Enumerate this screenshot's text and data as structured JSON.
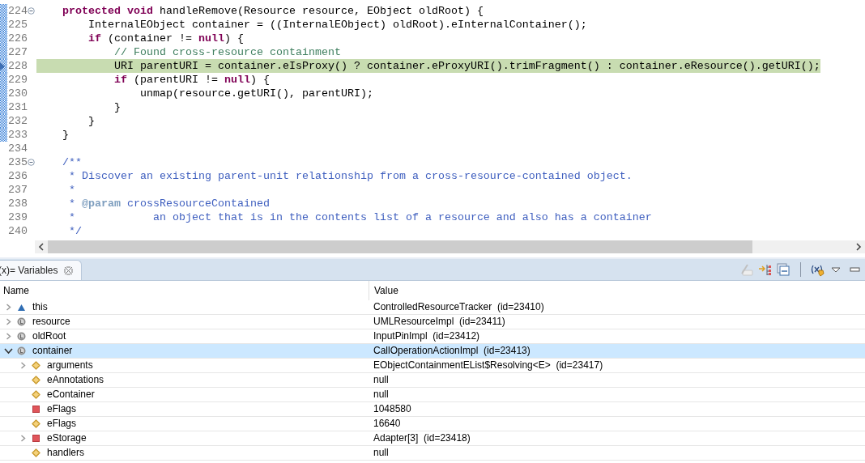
{
  "editor": {
    "lines": [
      {
        "number": "224",
        "in_range": true,
        "current": false,
        "foldable": true,
        "tokens": [
          {
            "kind": "keyword",
            "text": "    protected"
          },
          {
            "kind": "keyword",
            "text": " void"
          },
          {
            "kind": "plain",
            "text": " handleRemove(Resource resource, EObject oldRoot) {"
          }
        ]
      },
      {
        "number": "225",
        "in_range": true,
        "current": false,
        "foldable": false,
        "tokens": [
          {
            "kind": "plain",
            "text": "        InternalEObject container = ((InternalEObject) oldRoot).eInternalContainer();"
          }
        ]
      },
      {
        "number": "226",
        "in_range": true,
        "current": false,
        "foldable": false,
        "tokens": [
          {
            "kind": "keyword",
            "text": "        if"
          },
          {
            "kind": "plain",
            "text": " (container != "
          },
          {
            "kind": "keyword",
            "text": "null"
          },
          {
            "kind": "plain",
            "text": ") {"
          }
        ]
      },
      {
        "number": "227",
        "in_range": true,
        "current": false,
        "foldable": false,
        "tokens": [
          {
            "kind": "comment",
            "text": "            // Found cross-resource containment"
          }
        ]
      },
      {
        "number": "228",
        "in_range": true,
        "current": true,
        "foldable": false,
        "tokens": [
          {
            "kind": "plain",
            "text": "            URI parentURI = container.eIsProxy() ? container.eProxyURI().trimFragment() : container.eResource().getURI();"
          }
        ]
      },
      {
        "number": "229",
        "in_range": true,
        "current": false,
        "foldable": false,
        "tokens": [
          {
            "kind": "keyword",
            "text": "            if"
          },
          {
            "kind": "plain",
            "text": " (parentURI != "
          },
          {
            "kind": "keyword",
            "text": "null"
          },
          {
            "kind": "plain",
            "text": ") {"
          }
        ]
      },
      {
        "number": "230",
        "in_range": true,
        "current": false,
        "foldable": false,
        "tokens": [
          {
            "kind": "plain",
            "text": "                unmap(resource.getURI(), parentURI);"
          }
        ]
      },
      {
        "number": "231",
        "in_range": true,
        "current": false,
        "foldable": false,
        "tokens": [
          {
            "kind": "plain",
            "text": "            }"
          }
        ]
      },
      {
        "number": "232",
        "in_range": true,
        "current": false,
        "foldable": false,
        "tokens": [
          {
            "kind": "plain",
            "text": "        }"
          }
        ]
      },
      {
        "number": "233",
        "in_range": true,
        "current": false,
        "foldable": false,
        "tokens": [
          {
            "kind": "plain",
            "text": "    }"
          }
        ]
      },
      {
        "number": "234",
        "in_range": false,
        "current": false,
        "foldable": false
      },
      {
        "number": "235",
        "in_range": false,
        "current": false,
        "foldable": true,
        "tokens": [
          {
            "kind": "doc",
            "text": "    /**"
          }
        ]
      },
      {
        "number": "236",
        "in_range": false,
        "current": false,
        "foldable": false,
        "tokens": [
          {
            "kind": "doc",
            "text": "     * Discover an existing parent-unit relationship from a cross-resource-contained object."
          }
        ]
      },
      {
        "number": "237",
        "in_range": false,
        "current": false,
        "foldable": false,
        "tokens": [
          {
            "kind": "doc",
            "text": "     *"
          }
        ]
      },
      {
        "number": "238",
        "in_range": false,
        "current": false,
        "foldable": false,
        "tokens": [
          {
            "kind": "doc",
            "text": "     * "
          },
          {
            "kind": "doctag",
            "text": "@param"
          },
          {
            "kind": "doc",
            "text": " crossResourceContained"
          }
        ]
      },
      {
        "number": "239",
        "in_range": false,
        "current": false,
        "foldable": false,
        "tokens": [
          {
            "kind": "doc",
            "text": "     *            an object that is in the contents list of a resource and also has a container"
          }
        ]
      },
      {
        "number": "240",
        "in_range": false,
        "current": false,
        "foldable": false,
        "tokens": [
          {
            "kind": "doc",
            "text": "     */"
          }
        ]
      }
    ]
  },
  "variables_view": {
    "tab": {
      "label": "(x)= Variables",
      "selected": true
    },
    "toolbar": [
      {
        "kind": "pencil"
      },
      {
        "kind": "arrow-tree"
      },
      {
        "kind": "collapse"
      },
      {
        "kind": "separator"
      },
      {
        "kind": "variables"
      },
      {
        "kind": "menu"
      },
      {
        "kind": "minimize"
      }
    ],
    "columns": [
      "Name",
      "Value"
    ],
    "rows": [
      {
        "name": "this",
        "value": "ControlledResourceTracker  (id=23410)",
        "kind": "this",
        "expandable": true,
        "expanded": false,
        "selected": false
      },
      {
        "name": "resource",
        "value": "UMLResourceImpl  (id=23411)",
        "kind": "local",
        "expandable": true,
        "expanded": false,
        "selected": false
      },
      {
        "name": "oldRoot",
        "value": "InputPinImpl  (id=23412)",
        "kind": "local",
        "expandable": true,
        "expanded": false,
        "selected": false
      },
      {
        "name": "container",
        "value": "CallOperationActionImpl  (id=23413)",
        "kind": "local",
        "expandable": true,
        "expanded": true,
        "selected": true,
        "children": [
          {
            "name": "arguments",
            "value": "EObjectContainmentEList$Resolving<E>  (id=23417)",
            "kind": "protected",
            "expandable": true,
            "expanded": false,
            "selected": false
          },
          {
            "name": "eAnnotations",
            "value": "null",
            "kind": "protected",
            "expandable": false,
            "expanded": false,
            "selected": false
          },
          {
            "name": "eContainer",
            "value": "null",
            "kind": "protected",
            "expandable": false,
            "expanded": false,
            "selected": false
          },
          {
            "name": "eFlags",
            "value": "1048580",
            "kind": "private",
            "expandable": false,
            "expanded": false,
            "selected": false
          },
          {
            "name": "eFlags",
            "value": "16640",
            "kind": "protected",
            "expandable": false,
            "expanded": false,
            "selected": false
          },
          {
            "name": "eStorage",
            "value": "Adapter[3]  (id=23418)",
            "kind": "private",
            "expandable": true,
            "expanded": false,
            "selected": false
          },
          {
            "name": "handlers",
            "value": "null",
            "kind": "protected",
            "expandable": false,
            "expanded": false,
            "selected": false
          }
        ]
      }
    ]
  }
}
